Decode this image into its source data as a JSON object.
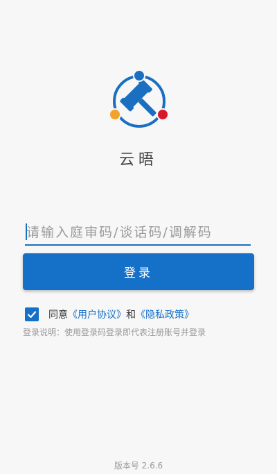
{
  "app": {
    "name": "云晤"
  },
  "login": {
    "input_placeholder": "请输入庭审码/谈话码/调解码",
    "input_value": "",
    "button_label": "登录"
  },
  "agreement": {
    "checked": true,
    "prefix": "同意",
    "user_agreement": "《用户协议》",
    "conjunction": "和",
    "privacy_policy": "《隐私政策》"
  },
  "note": "登录说明：使用登录码登录即代表注册账号并登录",
  "version": "版本号 2.6.6",
  "colors": {
    "primary": "#1570c7",
    "logo_blue": "#1a6fc0",
    "logo_orange": "#f3a32a",
    "logo_red": "#d7182a",
    "background": "#f7f7f7"
  }
}
